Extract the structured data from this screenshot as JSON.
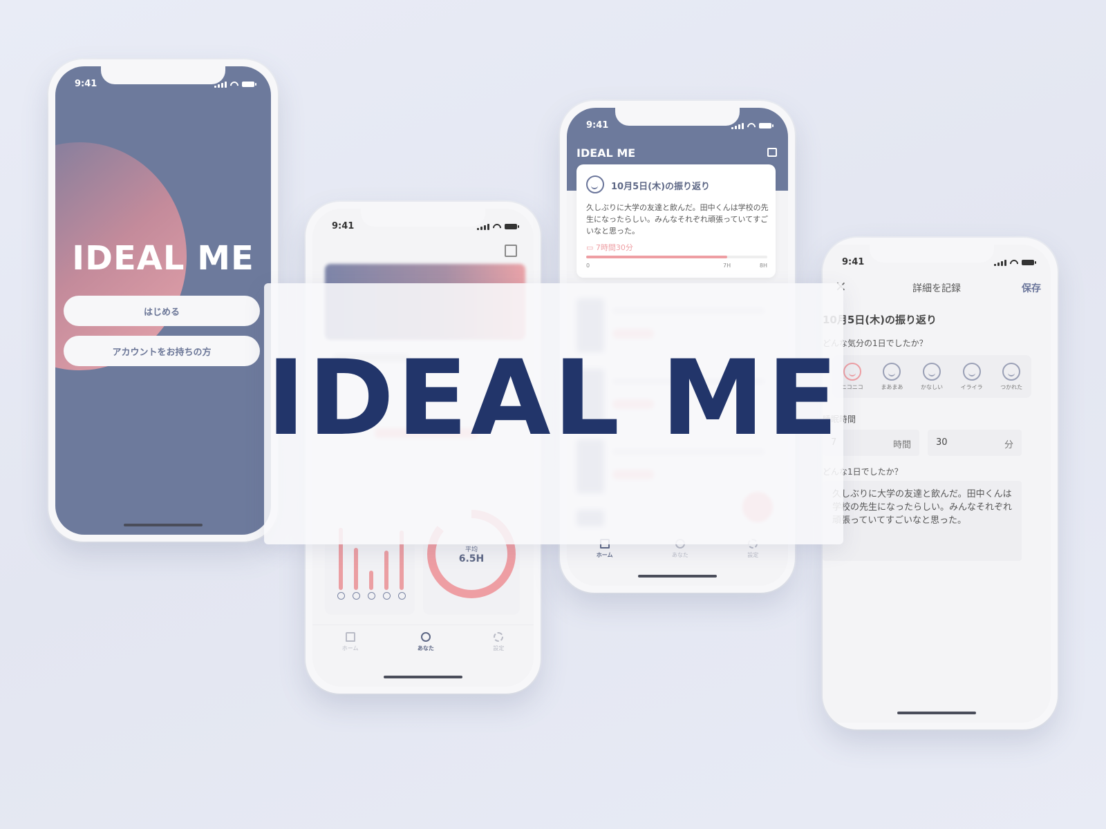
{
  "status_time": "9:41",
  "brand": "IDEAL ME",
  "colors": {
    "primary": "#6d7a9c",
    "accent": "#ee9ea3",
    "navy": "#22356a"
  },
  "splash": {
    "title": "IDEAL ME",
    "start_button": "はじめる",
    "login_button": "アカウントをお持ちの方"
  },
  "you_screen": {
    "donut_label": "平均",
    "donut_value": "6.5H",
    "mood_bars": [
      0.82,
      0.55,
      0.25,
      0.52,
      0.78
    ],
    "sleep_ratio": 0.86,
    "tabs": [
      {
        "label": "ホーム",
        "icon": "home-icon",
        "active": false
      },
      {
        "label": "あなた",
        "icon": "user-icon",
        "active": true
      },
      {
        "label": "設定",
        "icon": "gear-icon",
        "active": false
      }
    ]
  },
  "home_screen": {
    "app_title": "IDEAL ME",
    "entry_title": "10月5日(木)の振り返り",
    "entry_body": "久しぶりに大学の友達と飲んだ。田中くんは学校の先生になったらしい。みんなそれぞれ頑張っていてすごいなと思った。",
    "sleep_label": "7時間30分",
    "sleep_fraction": 0.78,
    "ticks": [
      "0",
      "7H",
      "8H"
    ],
    "tabs": [
      {
        "label": "ホーム",
        "icon": "home-icon",
        "active": true
      },
      {
        "label": "あなた",
        "icon": "user-icon",
        "active": false
      },
      {
        "label": "設定",
        "icon": "gear-icon",
        "active": false
      }
    ]
  },
  "detail_screen": {
    "close": "×",
    "title": "詳細を記録",
    "save": "保存",
    "section_title": "10月5日(木)の振り返り",
    "mood_question": "どんな気分の1日でしたか？",
    "moods": [
      "ニコニコ",
      "まあまあ",
      "かなしい",
      "イライラ",
      "つかれた"
    ],
    "selected_mood": 0,
    "sleep_heading": "睡眠時間",
    "hours_value": "7",
    "hours_unit": "時間",
    "minutes_value": "30",
    "minutes_unit": "分",
    "day_question": "どんな1日でしたか？",
    "day_text": "久しぶりに大学の友達と飲んだ。田中くんは学校の先生になったらしい。みんなそれぞれ頑張っていてすごいなと思った。"
  },
  "overlay_title": "IDEAL ME"
}
